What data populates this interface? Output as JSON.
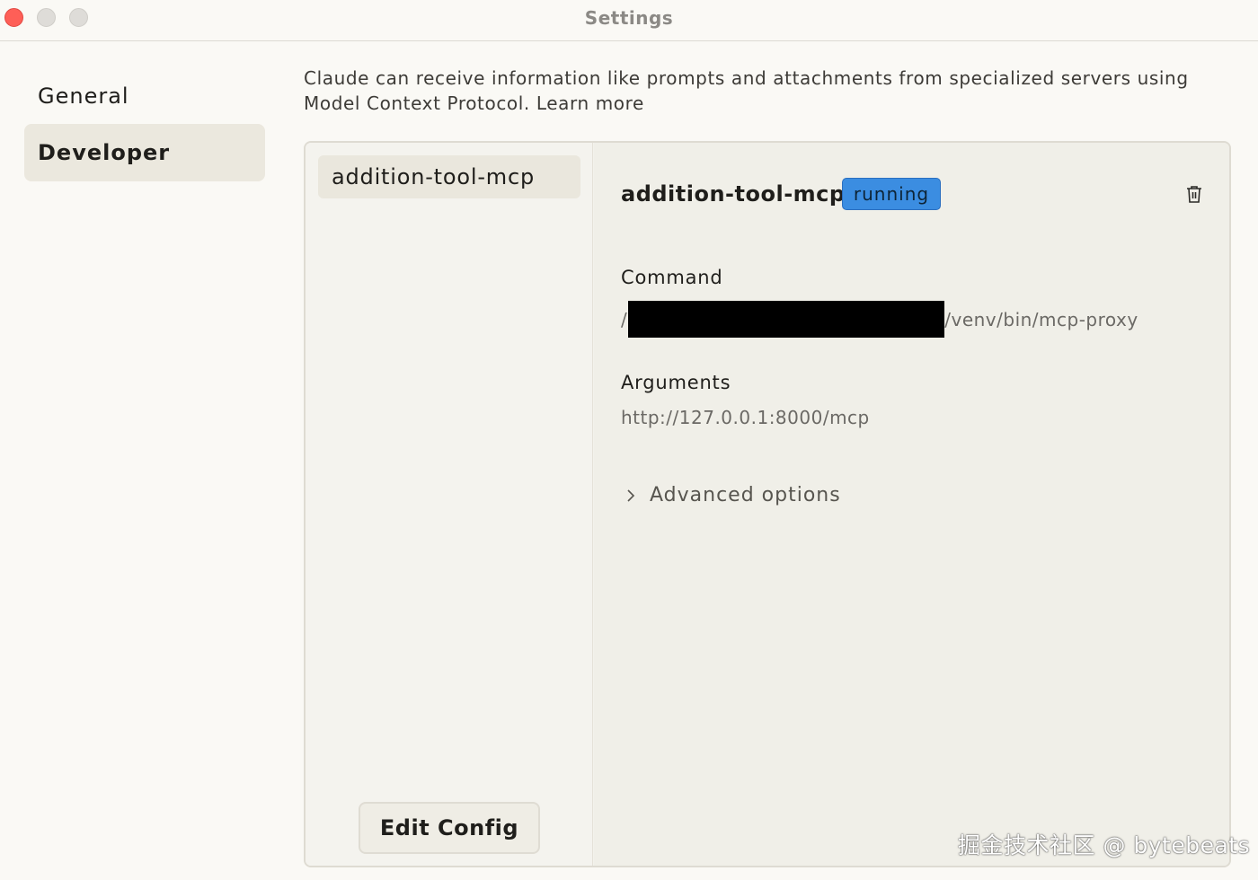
{
  "window": {
    "title": "Settings"
  },
  "nav": {
    "items": [
      {
        "label": "General"
      },
      {
        "label": "Developer"
      }
    ]
  },
  "description": {
    "text": "Claude can receive information like prompts and attachments from specialized servers using Model Context Protocol.",
    "link": "Learn more"
  },
  "servers": [
    {
      "name": "addition-tool-mcp"
    }
  ],
  "server_detail": {
    "name": "addition-tool-mcp",
    "status": "running",
    "command_label": "Command",
    "command_prefix": "/",
    "command_suffix": "/venv/bin/mcp-proxy",
    "arguments_label": "Arguments",
    "arguments_value": "http://127.0.0.1:8000/mcp",
    "advanced_label": "Advanced options"
  },
  "edit_config_label": "Edit Config",
  "watermark": "掘金技术社区 @ bytebeats",
  "colors": {
    "status_running": "#3b8de1",
    "background": "#faf9f5",
    "selected_nav": "#ebe8de"
  }
}
